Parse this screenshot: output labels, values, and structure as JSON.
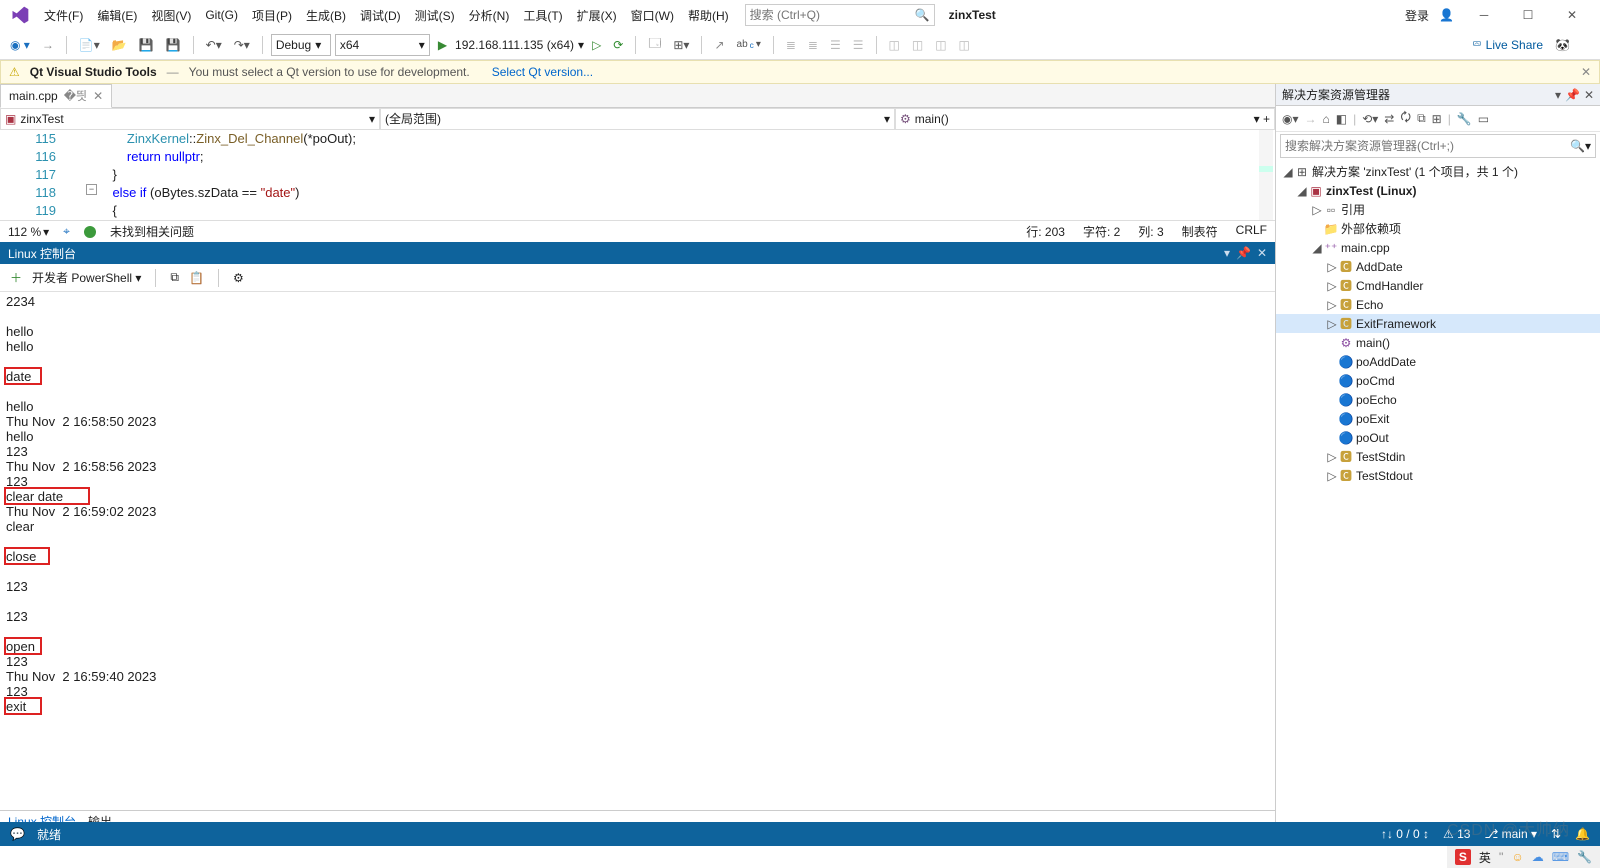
{
  "menus": [
    "文件(F)",
    "编辑(E)",
    "视图(V)",
    "Git(G)",
    "项目(P)",
    "生成(B)",
    "调试(D)",
    "测试(S)",
    "分析(N)",
    "工具(T)",
    "扩展(X)",
    "窗口(W)",
    "帮助(H)"
  ],
  "search": {
    "placeholder": "搜索 (Ctrl+Q)"
  },
  "solution_label": "zinxTest",
  "login": "登录",
  "toolbar": {
    "config": "Debug",
    "platform": "x64",
    "run_target": "192.168.111.135 (x64)",
    "liveshare": "Live Share"
  },
  "banner": {
    "title": "Qt Visual Studio Tools",
    "msg": "You must select a Qt version to use for development.",
    "link": "Select Qt version..."
  },
  "tab": {
    "filename": "main.cpp"
  },
  "nav": {
    "scope": "zinxTest",
    "center": "(全局范围)",
    "member": "main()"
  },
  "code": {
    "lines": [
      115,
      116,
      117,
      118,
      119
    ],
    "l115a": "ZinxKernel",
    "l115b": "::",
    "l115c": "Zinx_Del_Channel",
    "l115d": "(*poOut);",
    "l116a": "return",
    "l116b": " nullptr",
    "l116c": ";",
    "l117": "}",
    "l118a": "else if",
    "l118b": " (oBytes.szData == ",
    "l118c": "\"date\"",
    "l118d": ")",
    "l119": "{"
  },
  "code_status": {
    "zoom": "112 %",
    "noissue": "未找到相关问题",
    "line": "行: 203",
    "ch": "字符: 2",
    "col": "列: 3",
    "tab": "制表符",
    "crlf": "CRLF"
  },
  "panel": {
    "title": "Linux 控制台",
    "devps": "开发者 PowerShell",
    "bottom_tabs": [
      "Linux 控制台",
      "输出"
    ]
  },
  "terminal_lines": [
    "2234",
    "",
    "hello",
    "hello",
    "",
    "date",
    "",
    "hello",
    "Thu Nov  2 16:58:50 2023",
    "hello",
    "123",
    "Thu Nov  2 16:58:56 2023",
    "123",
    "clear date",
    "Thu Nov  2 16:59:02 2023",
    "clear",
    "",
    "close",
    "",
    "123",
    "",
    "123",
    "",
    "open",
    "123",
    "Thu Nov  2 16:59:40 2023",
    "123",
    "exit"
  ],
  "highlights": [
    {
      "text": "date",
      "line": 5
    },
    {
      "text": "clear date",
      "line": 13
    },
    {
      "text": "close",
      "line": 17
    },
    {
      "text": "open",
      "line": 23
    },
    {
      "text": "exit",
      "line": 27
    }
  ],
  "solex": {
    "title": "解决方案资源管理器",
    "search_placeholder": "搜索解决方案资源管理器(Ctrl+;)",
    "root": "解决方案 'zinxTest' (1 个项目，共 1 个)",
    "project": "zinxTest (Linux)",
    "refs": "引用",
    "ext": "外部依赖项",
    "mainfile": "main.cpp",
    "classes": [
      "AddDate",
      "CmdHandler",
      "Echo",
      "ExitFramework"
    ],
    "selected": "ExitFramework",
    "funcs": [
      "main()"
    ],
    "vars": [
      "poAddDate",
      "poCmd",
      "poEcho",
      "poExit",
      "poOut"
    ],
    "more": [
      "TestStdin",
      "TestStdout"
    ]
  },
  "status": {
    "ready": "就绪",
    "issues": "0 / 0",
    "warn": "13",
    "branch": "main"
  },
  "tray": {
    "ime": "英"
  },
  "watermark": "CSDN @大帅纳"
}
